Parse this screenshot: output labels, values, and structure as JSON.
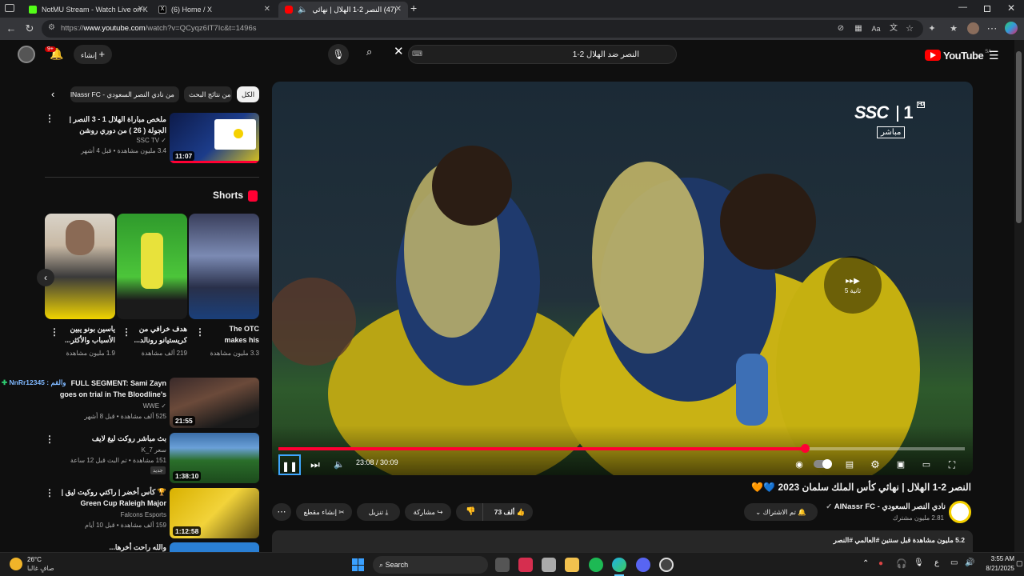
{
  "browser": {
    "tabs": [
      {
        "title": "NotMU Stream - Watch Live on K",
        "color": "#53fc18"
      },
      {
        "title": "(6) Home / X",
        "color": "#000000"
      },
      {
        "title": "(47) النصر 2-1 الهلال | نهائي",
        "color": "#ff0000"
      }
    ],
    "url_prefix": "https://",
    "url_host": "www.youtube.com",
    "url_path": "/watch?v=QCyqz6IT7Ic&t=1496s"
  },
  "yt": {
    "logo_text": "YouTube",
    "logo_region": "SA",
    "search_query": "النصر ضد الهلال 2-1",
    "create_label": "إنشاء",
    "notifications_count": "9+"
  },
  "chips": [
    "الكل",
    "من نتائج البحث",
    "من نادي النصر السعودي - AlNassr FC"
  ],
  "recommended_top": {
    "title": "ملخص مباراة الهلال 1 - 3 النصر | الجولة ( 26 ) من دوري روشن السعودي للمحترفين",
    "channel": "SSC TV",
    "meta": "3.4 مليون مشاهدة • قبل 4 أشهر",
    "duration": "11:07"
  },
  "shorts": {
    "heading": "Shorts",
    "items": [
      {
        "title": "The OTC makes his",
        "views": "3.3 مليون مشاهدة"
      },
      {
        "title": "هدف خرافي من كريستيانو رونالد...",
        "views": "219 ألف مشاهدة"
      },
      {
        "title": "ياسين بونو يبين الأسباب والأكثر...",
        "views": "1.9 مليون مشاهدة"
      }
    ]
  },
  "side_videos": [
    {
      "title": "FULL SEGMENT: Sami Zayn goes on trial in The Bloodline's",
      "channel": "WWE",
      "meta": "525 ألف مشاهدة • قبل 8 أشهر",
      "duration": "21:55",
      "overlay": "NnRr12345 : والقم"
    },
    {
      "title": "بث مباشر روكت ليغ لايف",
      "channel": "سعر K_7",
      "meta": "151 مشاهدة • تم البث قبل 12 ساعة",
      "duration": "1:38:10",
      "badge": "جديد"
    },
    {
      "title": "🏆 كأس أخضر | راكتي روكيت ليق | Green Cup Raleigh Major",
      "channel": "Falcons Esports",
      "meta": "159 ألف مشاهدة • قبل 10 أيام",
      "duration": "1:12:58"
    },
    {
      "title": "والله راحت أخرها...",
      "channel": "",
      "meta": "",
      "duration": ""
    }
  ],
  "player": {
    "broadcaster": "SSC",
    "channel_num": "1",
    "hd": "HD",
    "live_label": "مباشر",
    "time_current": "23:08",
    "time_total": "30:09",
    "progress_fraction": 0.767,
    "seek_back_label": "5 ثانية"
  },
  "video": {
    "title": "النصر 2-1 الهلال | نهائي كأس الملك سلمان 2023 💙🧡",
    "channel": "نادي النصر السعودي - AlNassr FC",
    "subs": "2.81 مليون مشترك",
    "subscribed_label": "تم الاشتراك",
    "likes": "73 ألف",
    "share_label": "مشاركة",
    "download_label": "تنزيل",
    "clip_label": "إنشاء مقطع",
    "desc_line": "5.2 مليون مشاهدة  قبل سنتين  #العالمي #النصر"
  },
  "taskbar": {
    "weather_temp": "26°C",
    "weather_desc": "صافٍ غالبا",
    "search_label": "Search",
    "time": "3:55 AM",
    "date": "8/21/2025",
    "lang": "ع"
  },
  "colors": {
    "accent": "#ff0033",
    "bg": "#0f0f0f",
    "chip": "#272727"
  }
}
